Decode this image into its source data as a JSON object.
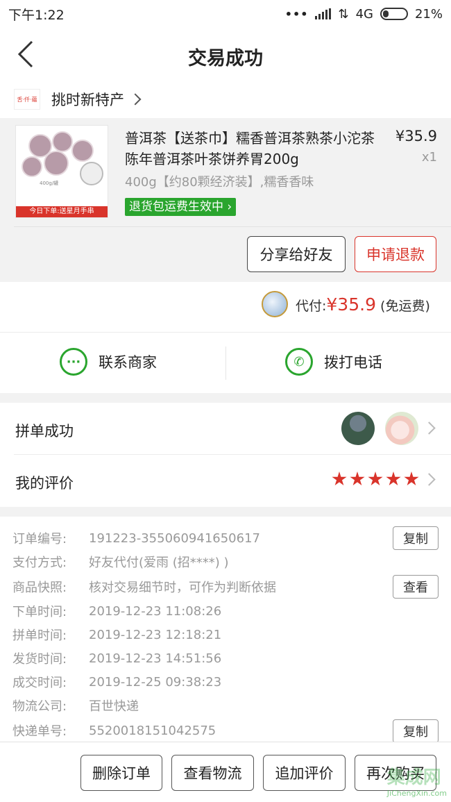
{
  "status_bar": {
    "time": "下午1:22",
    "network": "4G",
    "battery": "21%"
  },
  "nav": {
    "title": "交易成功"
  },
  "shop": {
    "logo_text": "舌·仟·蘊",
    "name": "挑时新特产"
  },
  "product": {
    "title": "普洱茶【送茶巾】糯香普洱茶熟茶小沱茶陈年普洱茶叶茶饼养胃200g",
    "price": "¥35.9",
    "qty": "x1",
    "spec": "400g【约80颗经济装】,糯香香味",
    "badge": "退货包运费生效中",
    "thumb_caption": "今日下单:送星月手串",
    "thumb_small": "400g/罐"
  },
  "actions": {
    "share": "分享给好友",
    "refund": "申请退款"
  },
  "payment": {
    "label": "代付:",
    "amount": "¥35.9",
    "note": "(免运费)"
  },
  "contact": {
    "merchant": "联系商家",
    "phone": "拨打电话"
  },
  "group": {
    "label": "拼单成功",
    "review_label": "我的评价",
    "rating": 5
  },
  "order_info": [
    {
      "key": "订单编号:",
      "value": "191223-355060941650617",
      "action": "复制"
    },
    {
      "key": "支付方式:",
      "value": "好友代付(爱雨 (招****) )"
    },
    {
      "key": "商品快照:",
      "value": "核对交易细节时，可作为判断依据",
      "action": "查看"
    },
    {
      "key": "下单时间:",
      "value": "2019-12-23 11:08:26"
    },
    {
      "key": "拼单时间:",
      "value": "2019-12-23 12:18:21"
    },
    {
      "key": "发货时间:",
      "value": "2019-12-23 14:51:56"
    },
    {
      "key": "成交时间:",
      "value": "2019-12-25 09:38:23"
    },
    {
      "key": "物流公司:",
      "value": "百世快递"
    },
    {
      "key": "快递单号:",
      "value": "5520018151042575",
      "action": "复制"
    }
  ],
  "bottom": {
    "delete": "删除订单",
    "logistics": "查看物流",
    "review": "追加评价",
    "rebuy": "再次购买"
  },
  "watermark": {
    "text": "集成网",
    "url": "JiChengXin.com"
  },
  "colors": {
    "accent": "#d9342b",
    "green": "#2aa52e"
  }
}
